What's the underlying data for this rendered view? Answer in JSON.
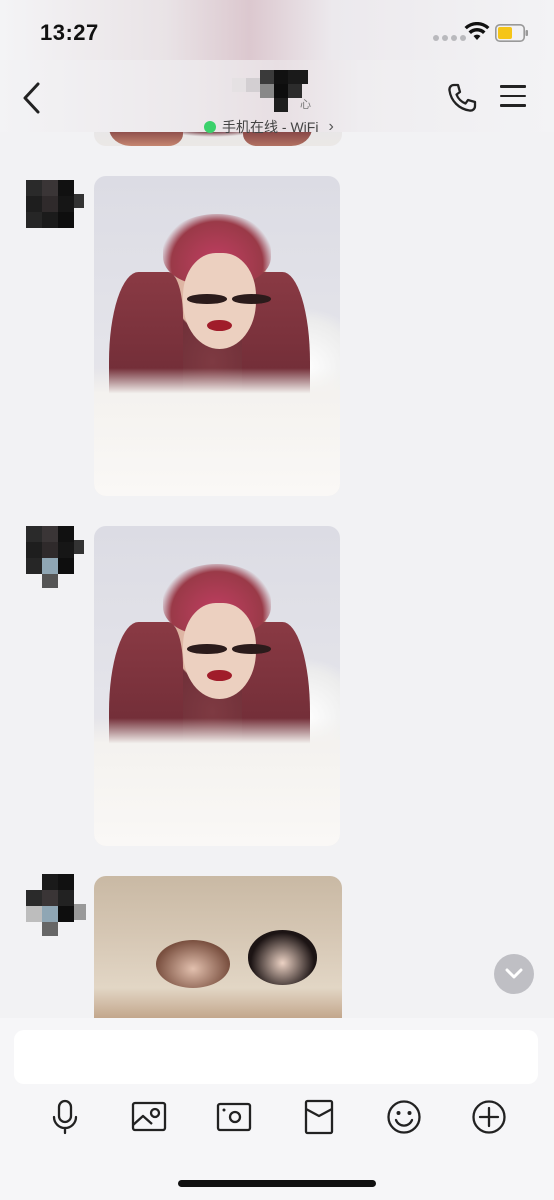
{
  "status_bar": {
    "time": "13:27",
    "battery_color": "#f5c518"
  },
  "nav": {
    "contact_fragment": "心",
    "online_text": "手机在线 - WiFi",
    "online_dot_color": "#3bd16b",
    "icons": [
      "back-icon",
      "phone-icon",
      "menu-icon"
    ]
  },
  "messages": [
    {
      "type": "image",
      "content": "portrait photo"
    },
    {
      "type": "image",
      "content": "portrait photo"
    },
    {
      "type": "image",
      "content": "group selfie photo"
    }
  ],
  "input": {
    "placeholder": "",
    "value": ""
  },
  "toolbar": {
    "icons": [
      "microphone-icon",
      "image-icon",
      "camera-icon",
      "red-packet-icon",
      "emoji-icon",
      "plus-icon"
    ]
  },
  "colors": {
    "background": "#f2f2f4",
    "accent": "#3bd16b"
  }
}
